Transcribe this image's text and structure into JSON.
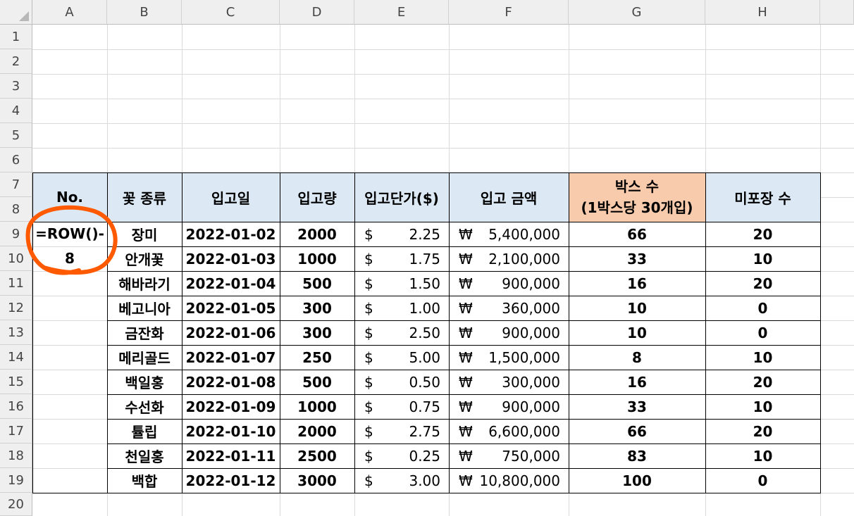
{
  "columns": [
    "A",
    "B",
    "C",
    "D",
    "E",
    "F",
    "G",
    "H"
  ],
  "rows": [
    "1",
    "2",
    "3",
    "4",
    "5",
    "6",
    "7",
    "8",
    "9",
    "10",
    "11",
    "12",
    "13",
    "14",
    "15",
    "16",
    "17",
    "18",
    "19",
    "20"
  ],
  "header": {
    "no": "No.",
    "flower": "꽃 종류",
    "date": "입고일",
    "qty": "입고량",
    "unit_price": "입고단가($)",
    "amount": "입고 금액",
    "boxes_line1": "박스 수",
    "boxes_line2": "(1박스당 30개입)",
    "unpacked": "미포장 수"
  },
  "formula_cell": {
    "line1": "=ROW()-",
    "line2": "8"
  },
  "currency": {
    "usd": "$",
    "krw": "₩"
  },
  "data_rows": [
    {
      "flower": "장미",
      "date": "2022-01-02",
      "qty": "2000",
      "price": "2.25",
      "amount": "5,400,000",
      "boxes": "66",
      "unpacked": "20"
    },
    {
      "flower": "안개꽃",
      "date": "2022-01-03",
      "qty": "1000",
      "price": "1.75",
      "amount": "2,100,000",
      "boxes": "33",
      "unpacked": "10"
    },
    {
      "flower": "해바라기",
      "date": "2022-01-04",
      "qty": "500",
      "price": "1.50",
      "amount": "900,000",
      "boxes": "16",
      "unpacked": "20"
    },
    {
      "flower": "베고니아",
      "date": "2022-01-05",
      "qty": "300",
      "price": "1.00",
      "amount": "360,000",
      "boxes": "10",
      "unpacked": "0"
    },
    {
      "flower": "금잔화",
      "date": "2022-01-06",
      "qty": "300",
      "price": "2.50",
      "amount": "900,000",
      "boxes": "10",
      "unpacked": "0"
    },
    {
      "flower": "메리골드",
      "date": "2022-01-07",
      "qty": "250",
      "price": "5.00",
      "amount": "1,500,000",
      "boxes": "8",
      "unpacked": "10"
    },
    {
      "flower": "백일홍",
      "date": "2022-01-08",
      "qty": "500",
      "price": "0.50",
      "amount": "300,000",
      "boxes": "16",
      "unpacked": "20"
    },
    {
      "flower": "수선화",
      "date": "2022-01-09",
      "qty": "1000",
      "price": "0.75",
      "amount": "900,000",
      "boxes": "33",
      "unpacked": "10"
    },
    {
      "flower": "튤립",
      "date": "2022-01-10",
      "qty": "2000",
      "price": "2.75",
      "amount": "6,600,000",
      "boxes": "66",
      "unpacked": "20"
    },
    {
      "flower": "천일홍",
      "date": "2022-01-11",
      "qty": "2500",
      "price": "0.25",
      "amount": "750,000",
      "boxes": "83",
      "unpacked": "10"
    },
    {
      "flower": "백합",
      "date": "2022-01-12",
      "qty": "3000",
      "price": "3.00",
      "amount": "10,800,000",
      "boxes": "100",
      "unpacked": "0"
    }
  ],
  "colors": {
    "header_fill": "#dce9f5",
    "box_header_fill": "#f8cbad",
    "annotation": "#ff5a00"
  },
  "annotation_icon": "hand-drawn-circle"
}
